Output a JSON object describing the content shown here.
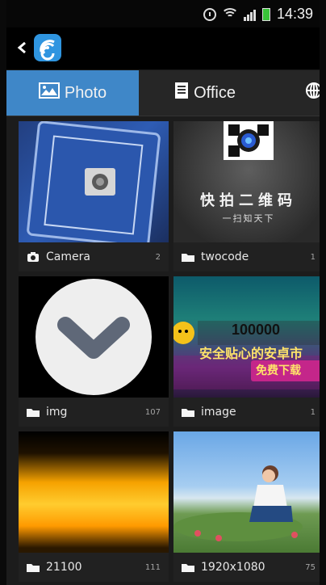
{
  "status_bar": {
    "time": "14:39"
  },
  "tabs": [
    {
      "label": "Photo",
      "active": true
    },
    {
      "label": "Office",
      "active": false
    }
  ],
  "albums": [
    {
      "name": "Camera",
      "count": "2"
    },
    {
      "name": "twocode",
      "count": "1"
    },
    {
      "name": "img",
      "count": "107"
    },
    {
      "name": "image",
      "count": "1"
    },
    {
      "name": "21100",
      "count": "111"
    },
    {
      "name": "1920x1080",
      "count": "75"
    }
  ],
  "thumb_texts": {
    "twocode_title": "快拍二维码",
    "twocode_sub": "一扫知天下",
    "image_number": "100000",
    "image_line": "安全贴心的安卓市",
    "image_cta": "免费下载"
  },
  "colors": {
    "accent": "#3f87c8",
    "logo": "#2f95e0"
  }
}
